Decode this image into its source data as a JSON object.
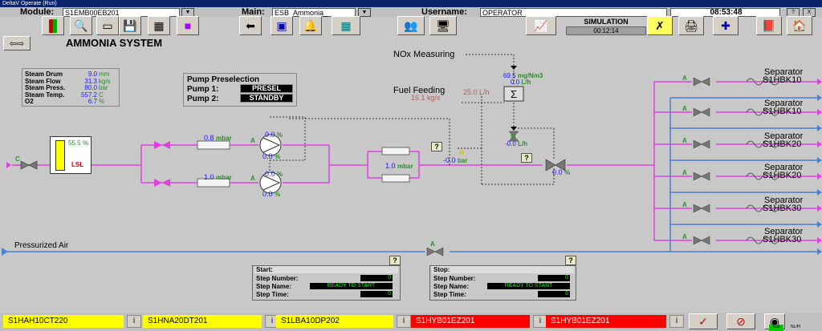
{
  "window_title": "DeltaV Operate (Run)",
  "header": {
    "module_label": "Module:",
    "module_value": "S1EMB00EB201",
    "main_label": "Main:",
    "main_value": "ESB_Ammonia_",
    "username_label": "Username:",
    "username_value": "OPERATOR",
    "time": "08:53:48",
    "help_btn": "?",
    "close_btn": "X"
  },
  "sim": {
    "label": "SIMULATION",
    "time": "00:12:14"
  },
  "page_title": "AMMONIA SYSTEM",
  "steam": {
    "rows": [
      {
        "label": "Steam Drum",
        "value": "9.0",
        "unit": "mm"
      },
      {
        "label": "Steam Flow",
        "value": "31.3",
        "unit": "kg/s"
      },
      {
        "label": "Steam Press.",
        "value": "80.0",
        "unit": "bar"
      },
      {
        "label": "Steam Temp.",
        "value": "557.2",
        "unit": "C"
      },
      {
        "label": "O2",
        "value": "6.7",
        "unit": "%"
      }
    ]
  },
  "pump_preselection": {
    "title": "Pump Preselection",
    "pump1_label": "Pump 1:",
    "pump1_value": "PRESEL",
    "pump2_label": "Pump 2:",
    "pump2_value": "STANDBY"
  },
  "nox": {
    "label": "NOx Measuring",
    "value": "69.5",
    "unit": "mg/Nm3",
    "flow_value": "0.0",
    "flow_unit": "L/h"
  },
  "fuel": {
    "label": "Fuel Feeding",
    "kgs_value": "16.1",
    "kgs_unit": "kg/s",
    "lh_value": "25.0",
    "lh_unit": "L/h"
  },
  "m_tag": "M",
  "m_value": "-0.0",
  "m_unit": "L/h",
  "tank": {
    "label": "LSL",
    "level": "55.5",
    "unit": "%"
  },
  "pumps": [
    {
      "dp": "0.8",
      "dp_unit": "mbar",
      "out": "0.0",
      "speed": "0.0",
      "unit": "%",
      "mode": "A"
    },
    {
      "dp": "1.0",
      "dp_unit": "mbar",
      "out": "0.0",
      "speed": "0.0",
      "unit": "%",
      "mode": "A"
    }
  ],
  "filter": {
    "dp": "1.0",
    "unit": "mbar"
  },
  "pressure": {
    "value": "-0.0",
    "unit": "bar",
    "tag": "H"
  },
  "control_valve": {
    "value": "0.0",
    "unit": "%"
  },
  "inlet_valve_mode": "C",
  "separators": [
    {
      "label": "Separator",
      "tag": "S1HBK10"
    },
    {
      "label": "Separator",
      "tag": "S1HBK10"
    },
    {
      "label": "Separator",
      "tag": "S1HBK20"
    },
    {
      "label": "Separator",
      "tag": "S1HBK20"
    },
    {
      "label": "Separator",
      "tag": "S1HBK30"
    },
    {
      "label": "Separator",
      "tag": "S1HBK30"
    }
  ],
  "mode_a": "A",
  "air": {
    "label": "Pressurized Air"
  },
  "start_panel": {
    "title": "Start:",
    "step_number_label": "Step Number:",
    "step_number": "0",
    "step_name_label": "Step Name:",
    "step_name": "READY TO START",
    "step_time_label": "Step Time:",
    "step_time": "0",
    "help": "?"
  },
  "stop_panel": {
    "title": "Stop:",
    "step_number_label": "Step Number:",
    "step_number": "0",
    "step_name_label": "Step Name:",
    "step_name": "READY TO START",
    "step_time_label": "Step Time:",
    "step_time": "0",
    "help": "?"
  },
  "alarms": [
    {
      "tag": "S1HAH10CT220",
      "color": "#ffff00",
      "text_color": "#000000"
    },
    {
      "tag": "S1HNA20DT201",
      "color": "#ffff00",
      "text_color": "#000000"
    },
    {
      "tag": "S1LBA10DP202",
      "color": "#ffff00",
      "text_color": "#000000"
    },
    {
      "tag": "S1HYB01EZ201",
      "color": "#ff0000",
      "text_color": "#ffffff"
    },
    {
      "tag": "S1HYB01EZ201",
      "color": "#ff0000",
      "text_color": "#ffffff"
    }
  ],
  "info_btn": "i",
  "status_indicators": {
    "run": "Run",
    "nl": "NL/PI"
  },
  "colors": {
    "ammonia_line": "#e040e0",
    "air_line": "#4a7fd0",
    "separator_line": "#4a7fd0",
    "green_text": "#2e8b2e",
    "value_blue": "#1a1aff"
  }
}
